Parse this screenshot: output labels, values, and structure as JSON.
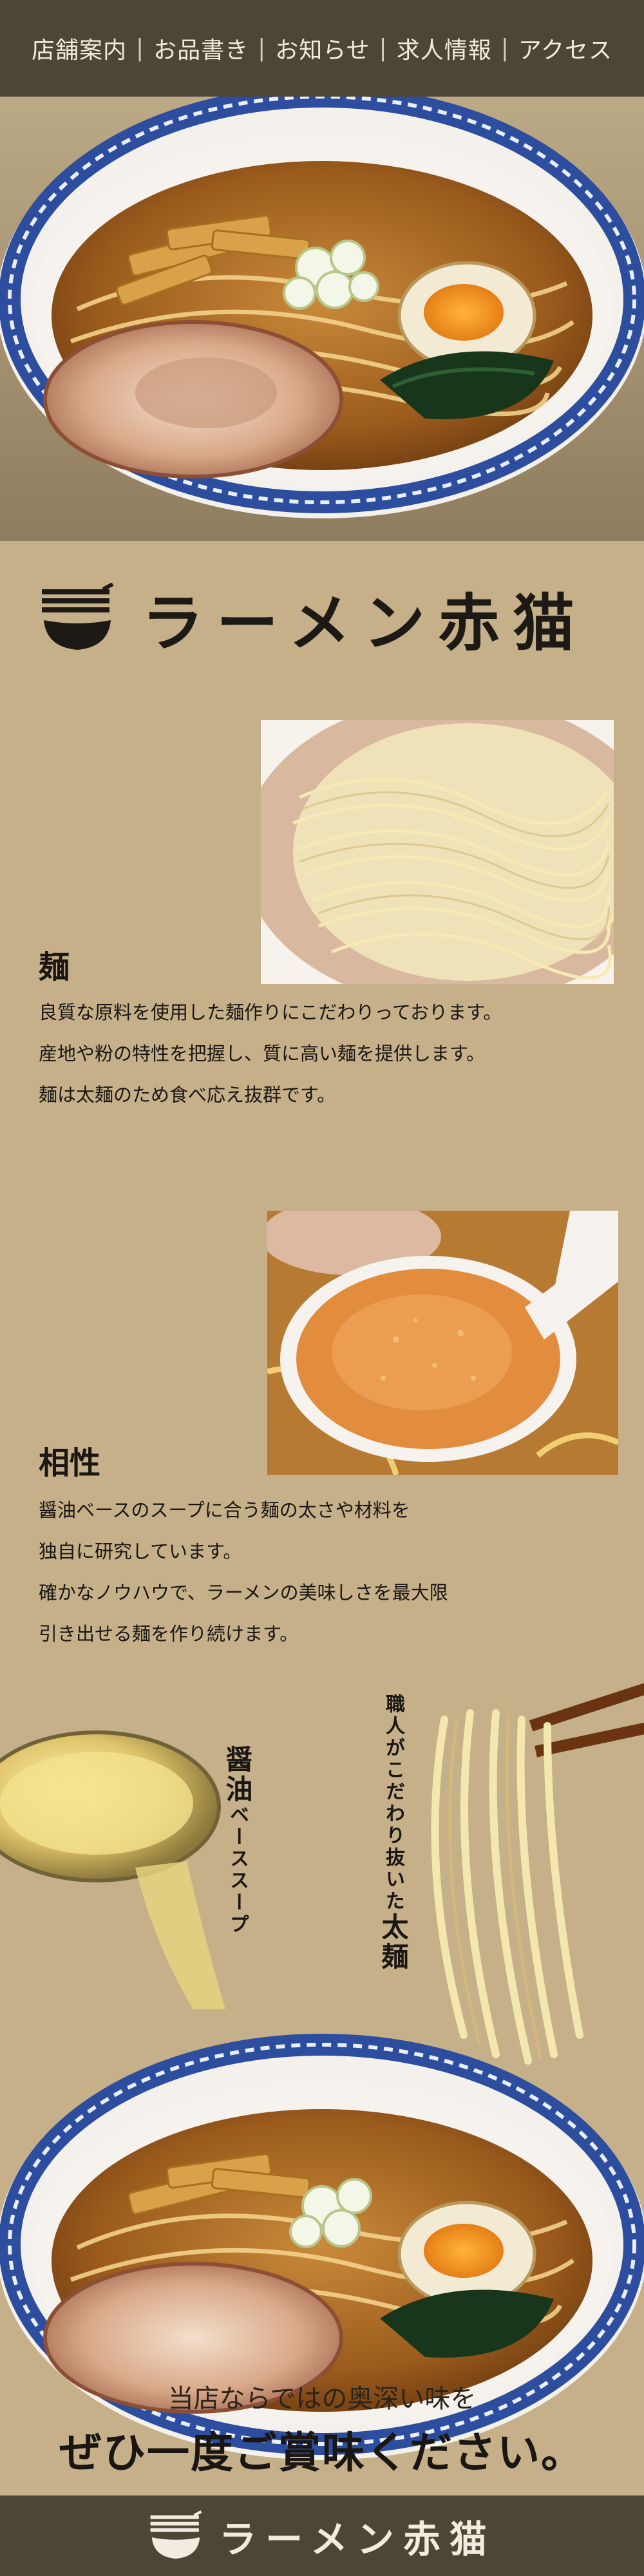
{
  "nav": {
    "items": [
      "店舗案内",
      "お品書き",
      "お知らせ",
      "求人情報",
      "アクセス"
    ],
    "separator": "|"
  },
  "brand": {
    "name": "ラーメン赤猫"
  },
  "sections": [
    {
      "title": "麺",
      "lines": [
        "良質な原料を使用した麺作りにこだわりっております。",
        "産地や粉の特性を把握し、質に高い麺を提供します。",
        "麺は太麺のため食べ応え抜群です。"
      ]
    },
    {
      "title": "相性",
      "lines": [
        "醤油ベースのスープに合う麺の太さや材料を",
        "独自に研究しています。",
        "確かなノウハウで、ラーメンの美味しさを最大限",
        "引き出せる麺を作り続けます。"
      ]
    }
  ],
  "callouts": {
    "soup_em": "醤油",
    "soup_rest": "ベーススープ",
    "noodle_rest": "職人がこだわり抜いた",
    "noodle_em": "太麺"
  },
  "cta": {
    "line1": "当店ならではの奥深い味を",
    "line2": "ぜひ一度ご賞味ください。"
  },
  "footer": {
    "name": "ラーメン赤猫"
  },
  "colors": {
    "background": "#c6b08a",
    "nav_bg": "#4d4536",
    "nav_text": "#f2ece0",
    "bowl_blue": "#2d4d9e"
  }
}
